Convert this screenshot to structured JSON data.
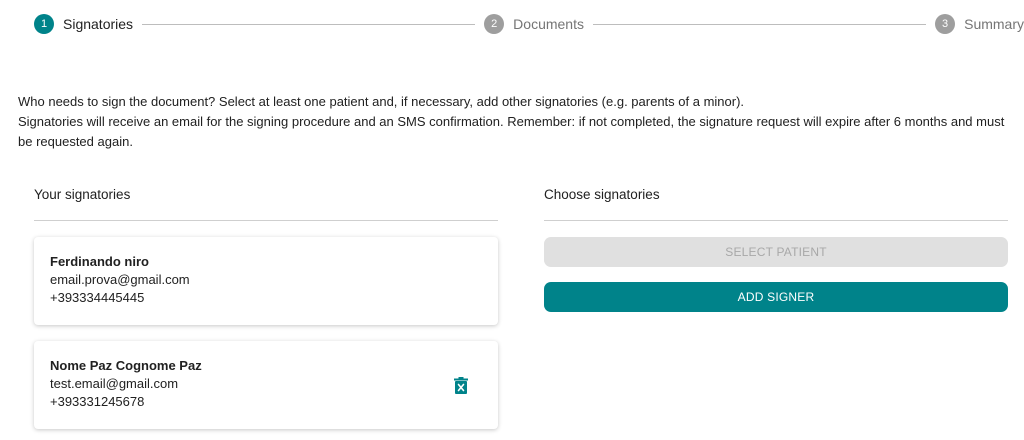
{
  "stepper": {
    "steps": [
      {
        "number": "1",
        "label": "Signatories",
        "state": "active"
      },
      {
        "number": "2",
        "label": "Documents",
        "state": "inactive"
      },
      {
        "number": "3",
        "label": "Summary",
        "state": "inactive"
      }
    ]
  },
  "intro": {
    "line1": "Who needs to sign the document? Select at least one patient and, if necessary, add other signatories (e.g. parents of a minor).",
    "line2": "Signatories will receive an email for the signing procedure and an SMS confirmation. Remember: if not completed, the signature request will expire after 6 months and must be requested again."
  },
  "your_signatories": {
    "title": "Your signatories",
    "items": [
      {
        "name": "Ferdinando niro",
        "email": "email.prova@gmail.com",
        "phone": "+393334445445",
        "deletable": false
      },
      {
        "name": "Nome Paz Cognome Paz",
        "email": "test.email@gmail.com",
        "phone": "+393331245678",
        "deletable": true
      }
    ]
  },
  "choose_signatories": {
    "title": "Choose signatories",
    "select_patient_label": "SELECT PATIENT",
    "add_signer_label": "ADD SIGNER"
  },
  "colors": {
    "accent": "#00838a",
    "disabled_bg": "#e0e0e0",
    "disabled_text": "#a8a8a8",
    "step_inactive": "#9e9e9e"
  }
}
